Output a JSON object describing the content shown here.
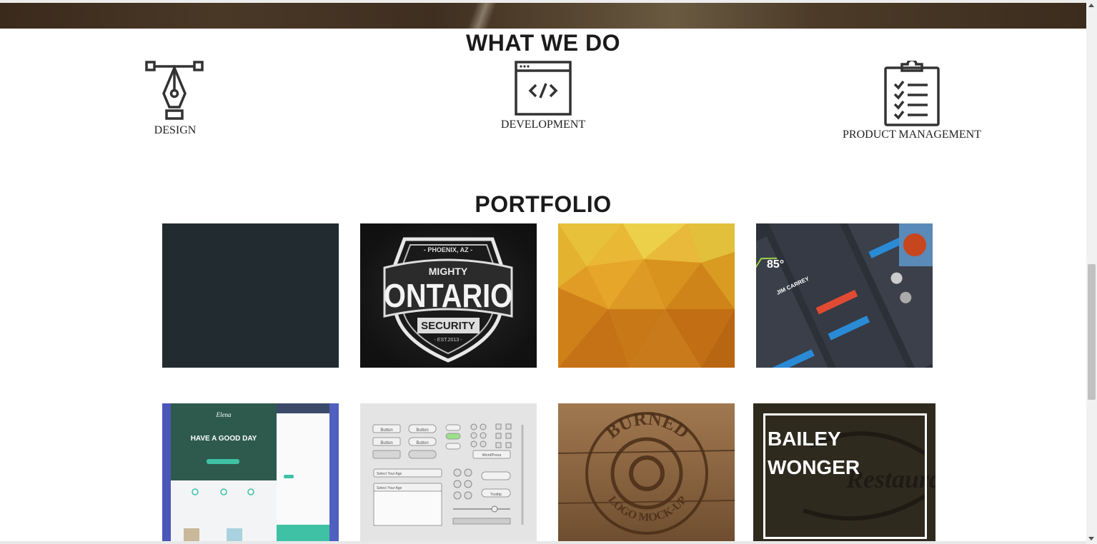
{
  "services_section": {
    "title": "WHAT WE DO",
    "items": [
      {
        "label": "DESIGN",
        "icon": "pen-tool-icon"
      },
      {
        "label": "DEVELOPMENT",
        "icon": "code-window-icon"
      },
      {
        "label": "PRODUCT MANAGEMENT",
        "icon": "clipboard-checklist-icon"
      }
    ]
  },
  "portfolio_section": {
    "title": "PORTFOLIO",
    "tiles": [
      {
        "name": "dark-slate"
      },
      {
        "name": "mighty-ontario-security-logo",
        "text": [
          "- PHOENIX, AZ -",
          "MIGHTY",
          "ONTARIO",
          "SECURITY",
          "- EST.2013 -"
        ]
      },
      {
        "name": "yellow-polygon-background"
      },
      {
        "name": "dark-ui-kit",
        "text": [
          "85°",
          "JIM CARREY"
        ]
      },
      {
        "name": "elena-landing-page",
        "text": [
          "Elena",
          "HAVE A GOOD DAY"
        ]
      },
      {
        "name": "light-ui-controls",
        "text": [
          "Button",
          "Select Your Age",
          "WordPress",
          "Tooltip"
        ]
      },
      {
        "name": "burned-logo-mockup",
        "text": [
          "BURNED",
          "LOGO MOCK-UP"
        ]
      },
      {
        "name": "bailey-wonger-overlay",
        "text": [
          "BAILEY",
          "WONGER"
        ]
      }
    ]
  },
  "colors": {
    "heading": "#1b1b1b",
    "icon_stroke": "#333333",
    "tile_dark": "#222b2f"
  }
}
